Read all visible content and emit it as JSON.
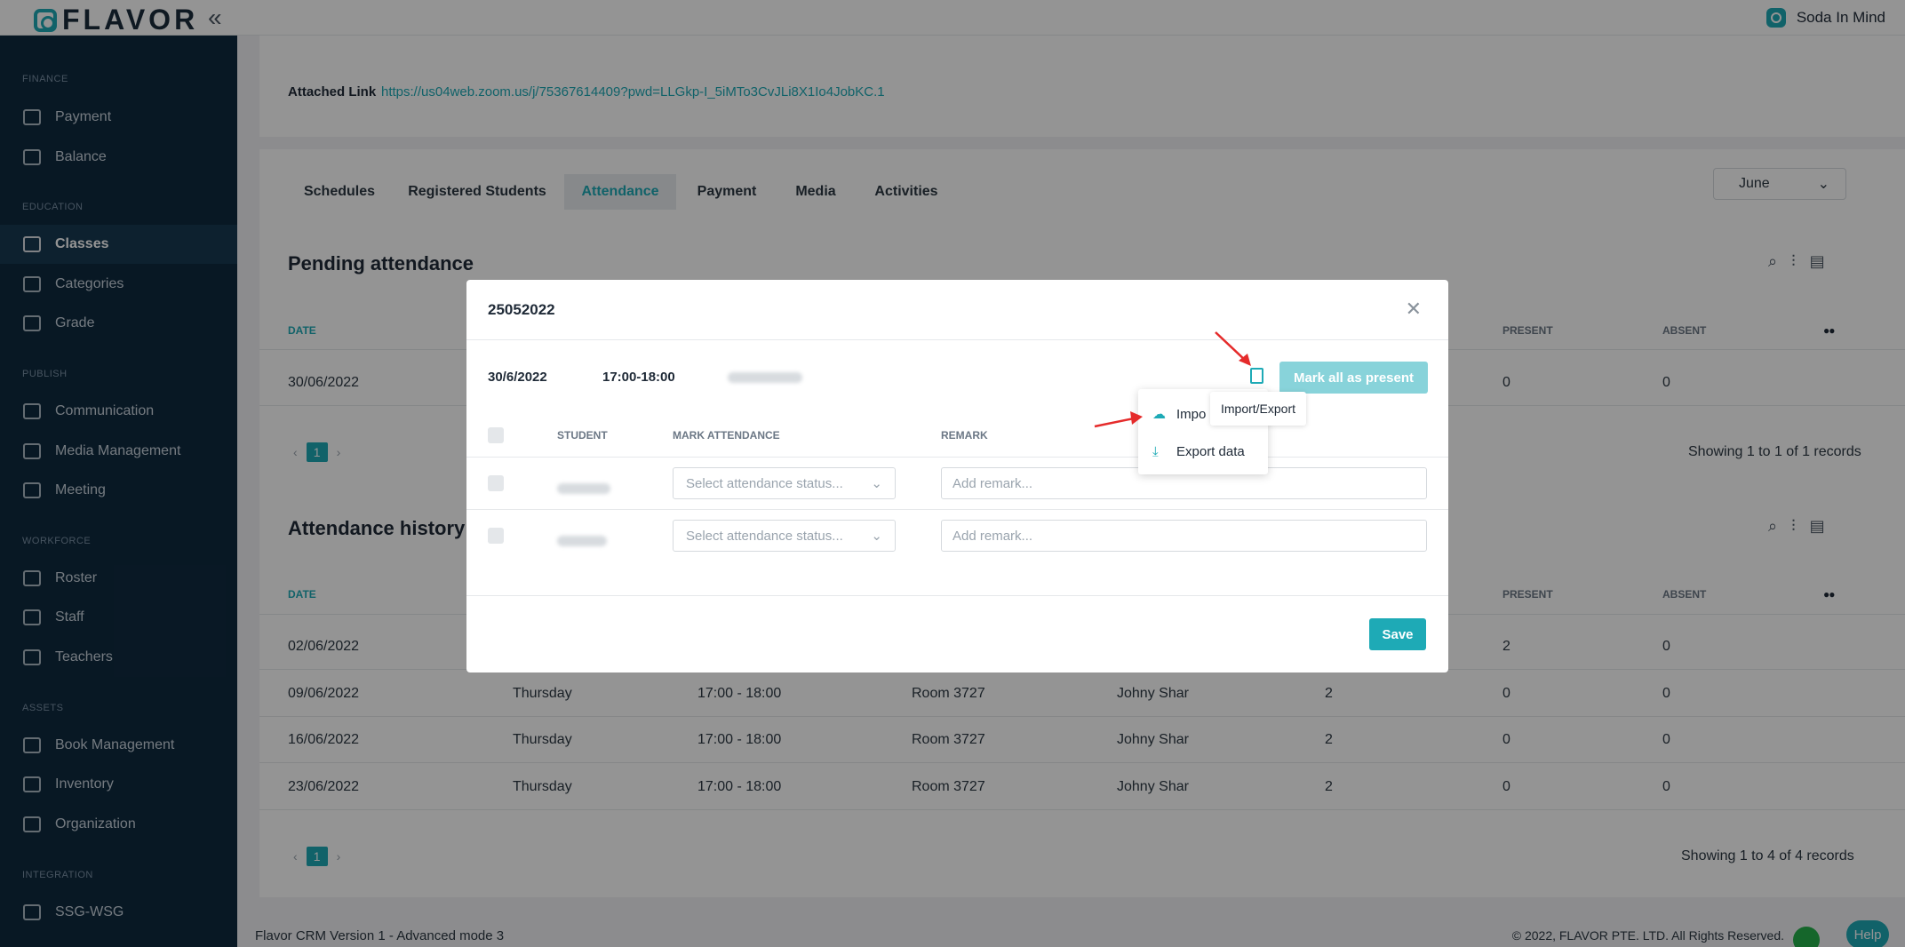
{
  "app": {
    "logo_text": "FLAVOR",
    "collapse_glyph": "«",
    "org_name": "Soda In Mind"
  },
  "sidebar": {
    "sections": [
      {
        "title": "FINANCE",
        "items": [
          {
            "label": "Payment",
            "icon": "card-icon"
          },
          {
            "label": "Balance",
            "icon": "building-icon"
          }
        ]
      },
      {
        "title": "EDUCATION",
        "items": [
          {
            "label": "Classes",
            "icon": "book-icon",
            "active": true
          },
          {
            "label": "Categories",
            "icon": "layers-icon"
          },
          {
            "label": "Grade",
            "icon": "award-icon"
          }
        ]
      },
      {
        "title": "PUBLISH",
        "items": [
          {
            "label": "Communication",
            "icon": "chat-icon"
          },
          {
            "label": "Media Management",
            "icon": "image-icon"
          },
          {
            "label": "Meeting",
            "icon": "meeting-icon"
          }
        ]
      },
      {
        "title": "WORKFORCE",
        "items": [
          {
            "label": "Roster",
            "icon": "calendar-icon"
          },
          {
            "label": "Staff",
            "icon": "users-icon"
          },
          {
            "label": "Teachers",
            "icon": "cap-icon"
          }
        ]
      },
      {
        "title": "ASSETS",
        "items": [
          {
            "label": "Book Management",
            "icon": "book-icon"
          },
          {
            "label": "Inventory",
            "icon": "box-icon"
          },
          {
            "label": "Organization",
            "icon": "org-icon"
          }
        ]
      },
      {
        "title": "INTEGRATION",
        "items": [
          {
            "label": "SSG-WSG",
            "icon": "stack-icon"
          }
        ]
      }
    ]
  },
  "detail": {
    "attached_link_label": "Attached Link",
    "attached_link_url": "https://us04web.zoom.us/j/75367614409?pwd=LLGkp-I_5iMTo3CvJLi8X1Io4JobKC.1"
  },
  "tabs": [
    "Schedules",
    "Registered Students",
    "Attendance",
    "Payment",
    "Media",
    "Activities"
  ],
  "active_tab": "Attendance",
  "month_select": "June",
  "pending": {
    "title": "Pending attendance",
    "headers": {
      "date": "DATE",
      "present": "PRESENT",
      "absent": "ABSENT"
    },
    "row": {
      "date": "30/06/2022",
      "present": "0",
      "absent": "0"
    },
    "page": "1",
    "records": "Showing 1 to 1 of 1 records"
  },
  "history": {
    "title": "Attendance history",
    "headers": {
      "date": "DATE",
      "present": "PRESENT",
      "absent": "ABSENT"
    },
    "rows": [
      {
        "date": "02/06/2022",
        "day": "",
        "time": "",
        "room": "",
        "teacher": "",
        "count": "",
        "present": "2",
        "absent": "0"
      },
      {
        "date": "09/06/2022",
        "day": "Thursday",
        "time": "17:00 - 18:00",
        "room": "Room 3727",
        "teacher": "Johny Shar",
        "count": "2",
        "present": "0",
        "absent": "0"
      },
      {
        "date": "16/06/2022",
        "day": "Thursday",
        "time": "17:00 - 18:00",
        "room": "Room 3727",
        "teacher": "Johny Shar",
        "count": "2",
        "present": "0",
        "absent": "0"
      },
      {
        "date": "23/06/2022",
        "day": "Thursday",
        "time": "17:00 - 18:00",
        "room": "Room 3727",
        "teacher": "Johny Shar",
        "count": "2",
        "present": "0",
        "absent": "0"
      }
    ],
    "page": "1",
    "records": "Showing 1 to 4 of 4 records"
  },
  "modal": {
    "title": "25052022",
    "date": "30/6/2022",
    "time": "17:00-18:00",
    "mark_all_label": "Mark all as present",
    "headers": {
      "student": "STUDENT",
      "mark_attendance": "MARK ATTENDANCE",
      "remark": "REMARK"
    },
    "select_placeholder": "Select attendance status...",
    "remark_placeholder": "Add remark...",
    "save_label": "Save"
  },
  "menu": {
    "import_label": "Impo",
    "export_label": "Export data",
    "tooltip": "Import/Export"
  },
  "footer": {
    "version": "Flavor CRM Version 1 - Advanced mode 3",
    "copyright": "© 2022, FLAVOR PTE. LTD. All Rights Reserved.",
    "help": "Help"
  },
  "colors": {
    "accent": "#1eaab6",
    "sidebar_bg": "#0f2a3f",
    "arrow": "#e52b2b"
  }
}
